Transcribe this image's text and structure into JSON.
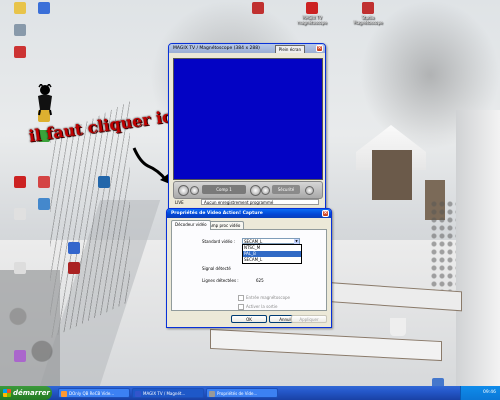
{
  "desktop": {
    "icons": [
      {
        "label": "",
        "color": "#e8c44a"
      },
      {
        "label": "",
        "color": "#3a6fd8"
      },
      {
        "label": "",
        "color": "#8899aa"
      },
      {
        "label": "",
        "color": "#cc3333"
      },
      {
        "label": "",
        "color": "#ddb030"
      },
      {
        "label": "",
        "color": "#3aa23a"
      },
      {
        "label": "",
        "color": "#cc2222"
      },
      {
        "label": "",
        "color": "#d44444"
      },
      {
        "label": "",
        "color": "#2266aa"
      },
      {
        "label": "",
        "color": "#4488cc"
      },
      {
        "label": "",
        "color": "#e0e0e0"
      },
      {
        "label": "",
        "color": "#3366cc"
      },
      {
        "label": "",
        "color": "#dddddd"
      },
      {
        "label": "",
        "color": "#aa2222"
      },
      {
        "label": "",
        "color": "#c03030"
      },
      {
        "label": "",
        "color": "#cc3355"
      },
      {
        "label": "",
        "color": "#4477cc"
      },
      {
        "label": "",
        "color": "#aa66cc"
      }
    ],
    "named_icons": {
      "magix_tv": "MAGIX TV magnétoscope",
      "studio": "Studio Magnétoscope"
    }
  },
  "annotation": {
    "text": "il faut cliquer ici"
  },
  "magnetoscope": {
    "title": "MAGIX TV / Magnétoscope (384 x 288)",
    "panel_button": "Plein écran",
    "channel": "Comp 1",
    "seconds": "Sécurité",
    "live_label": "LIVE",
    "status_message": "Aucun enregistrement programmé"
  },
  "properties_dialog": {
    "title": "Propriétés de Video Action! Capture",
    "tabs": [
      "Décodeur vidéo",
      "Amp proc vidéo"
    ],
    "standard_label": "Standard vidéo :",
    "standard_value": "SECAM_L",
    "options": [
      "NTSC_M",
      "PAL_B",
      "SECAM_L"
    ],
    "selected_option": "PAL_B",
    "signal_label": "Signal détecté",
    "lines_label": "Lignes détectées :",
    "lines_value": "625",
    "checkbox1": "Entrée magnétoscope",
    "checkbox2": "Activer la sortie",
    "ok": "OK",
    "cancel": "Annuler",
    "apply": "Appliquer"
  },
  "taskbar": {
    "start_label": "démarrer",
    "tasks": [
      {
        "label": "DOnly QB ReCB Vide...",
        "color": "#ff9933"
      },
      {
        "label": "MAGIX TV / Magnét...",
        "color": "#3355cc"
      },
      {
        "label": "Propriétés de Vide...",
        "color": "#999999"
      }
    ],
    "clock": "09:46"
  },
  "colors": {
    "video_background": "#0303c4",
    "xp_title_blue": "#0246d5",
    "taskbar_blue": "#2457c9",
    "start_green": "#2f8a2f",
    "annotation_red": "#c00000"
  }
}
